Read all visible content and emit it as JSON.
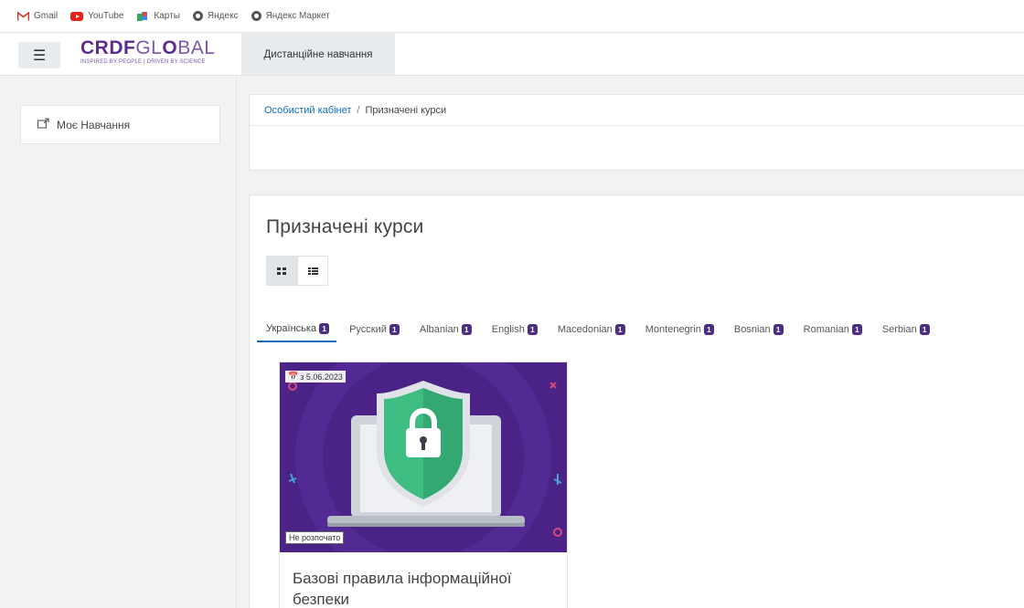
{
  "bookmarks": [
    {
      "label": "Gmail",
      "icon": "gmail-icon"
    },
    {
      "label": "YouTube",
      "icon": "youtube-icon"
    },
    {
      "label": "Карты",
      "icon": "maps-icon"
    },
    {
      "label": "Яндекс",
      "icon": "globe-icon"
    },
    {
      "label": "Яндекс Маркет",
      "icon": "globe-icon"
    }
  ],
  "navbar": {
    "logo_main": "CRDF",
    "logo_light": "GL",
    "logo_o": "O",
    "logo_end": "BAL",
    "logo_tagline": "INSPIRED BY PEOPLE | DRIVEN BY SCIENCE",
    "tab_label": "Дистанційне навчання"
  },
  "sidebar": {
    "items": [
      {
        "label": "Моє Навчання",
        "icon": "learning-icon"
      }
    ]
  },
  "breadcrumb": {
    "home": "Особистий кабінет",
    "separator": "/",
    "current": "Призначені курси"
  },
  "main": {
    "title": "Призначені курси",
    "lang_tabs": [
      {
        "label": "Українська",
        "count": "1"
      },
      {
        "label": "Русский",
        "count": "1"
      },
      {
        "label": "Albanian",
        "count": "1"
      },
      {
        "label": "English",
        "count": "1"
      },
      {
        "label": "Macedonian",
        "count": "1"
      },
      {
        "label": "Montenegrin",
        "count": "1"
      },
      {
        "label": "Bosnian",
        "count": "1"
      },
      {
        "label": "Romanian",
        "count": "1"
      },
      {
        "label": "Serbian",
        "count": "1"
      }
    ],
    "course": {
      "date": "з 5.06.2023",
      "status": "Не розпочато",
      "name": "Базові правила інформаційної безпеки"
    }
  },
  "colors": {
    "accent": "#0f6cbf",
    "badge": "#4b2d83",
    "brand": "#5b2d8e",
    "course_bg": "#4b2286",
    "shield": "#3dbd82"
  }
}
